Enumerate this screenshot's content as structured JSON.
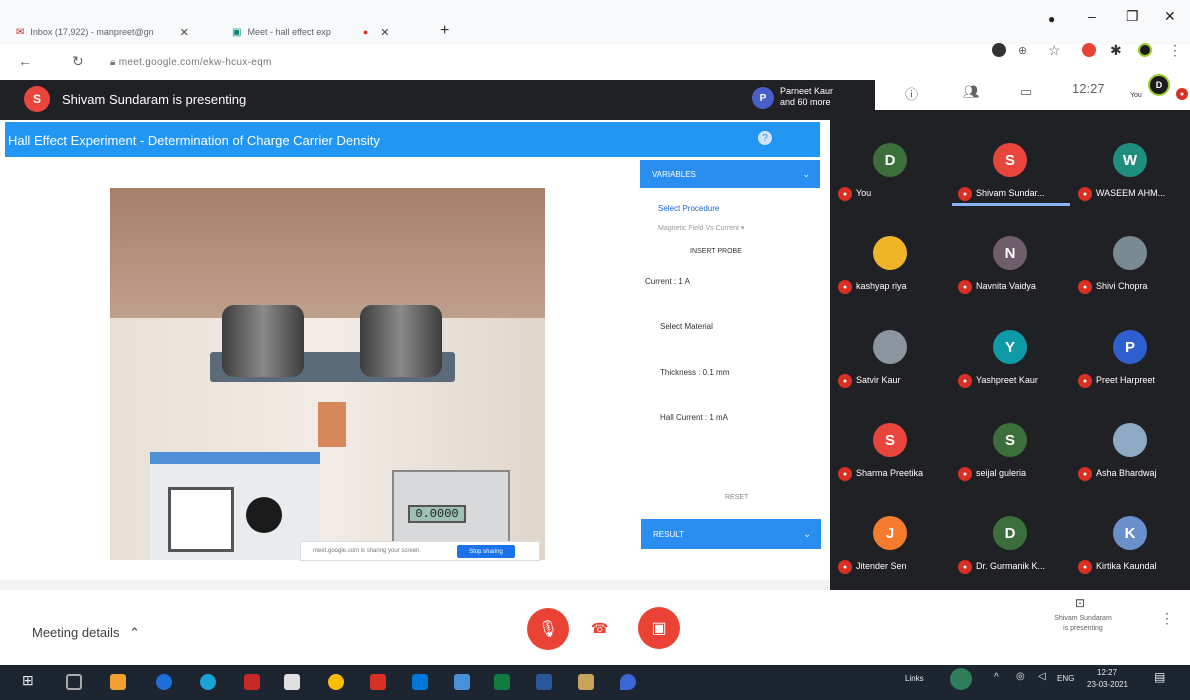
{
  "browser": {
    "tabs": [
      {
        "label": "Inbox (17,922) - manpreet@gn"
      },
      {
        "label": "Meet - hall effect exp"
      }
    ],
    "url": "meet.google.com/ekw-hcux-eqm"
  },
  "meet": {
    "presenter_name": "Shivam Sundaram is presenting",
    "presenter_initial": "S",
    "others_initial": "P",
    "others_line1": "Parneet Kaur",
    "others_line2": "and 60 more",
    "top_clock": "12:27",
    "you_label": "You",
    "you_initial": "D"
  },
  "experiment": {
    "title": "Hall Effect Experiment - Determination of Charge Carrier Density",
    "help": "?",
    "lcd_value": "0.0000",
    "share_notice": "meet.google.com is sharing your screen.",
    "stop_sharing": "Stop sharing",
    "panel": {
      "header": "VARIABLES",
      "select_procedure": "Select Procedure",
      "procedure_value": "Magnetic Field Vs Current",
      "insert_probe": "INSERT PROBE",
      "current": "Current : 1 A",
      "select_material": "Select Material",
      "thickness": "Thickness : 0.1 mm",
      "hall_current": "Hall Current : 1 mA",
      "reset": "RESET",
      "result": "RESULT"
    }
  },
  "participants": [
    {
      "name": "You",
      "initial": "D",
      "color": "#3c6e3c"
    },
    {
      "name": "Shivam Sundar...",
      "initial": "S",
      "color": "#e8453c"
    },
    {
      "name": "WASEEM AHM...",
      "initial": "W",
      "color": "#1e8e7e"
    },
    {
      "name": "kashyap riya",
      "initial": "",
      "color": "#f0b429"
    },
    {
      "name": "Navnita Vaidya",
      "initial": "N",
      "color": "#6d5e6a"
    },
    {
      "name": "Shivi Chopra",
      "initial": "",
      "color": "#7a8a94"
    },
    {
      "name": "Satvir Kaur",
      "initial": "",
      "color": "#8a95a0"
    },
    {
      "name": "Yashpreet Kaur",
      "initial": "Y",
      "color": "#0f9aa8"
    },
    {
      "name": "Preet Harpreet",
      "initial": "P",
      "color": "#2f5fcf"
    },
    {
      "name": "Sharma Preetika",
      "initial": "S",
      "color": "#e8453c"
    },
    {
      "name": "seijal guleria",
      "initial": "S",
      "color": "#3c6e3c"
    },
    {
      "name": "Asha Bhardwaj",
      "initial": "",
      "color": "#8fa9c4"
    },
    {
      "name": "Jitender Sen",
      "initial": "J",
      "color": "#f57c2e"
    },
    {
      "name": "Dr. Gurmanik K...",
      "initial": "D",
      "color": "#3c6e3c"
    },
    {
      "name": "Kirtika Kaundal",
      "initial": "K",
      "color": "#6b8fc9"
    }
  ],
  "bottom": {
    "meeting_details": "Meeting details",
    "present_line1": "Shivam Sundaram",
    "present_line2": "is presenting"
  },
  "taskbar": {
    "links": "Links",
    "lang": "ENG",
    "time": "12:27",
    "date": "23-03-2021"
  }
}
